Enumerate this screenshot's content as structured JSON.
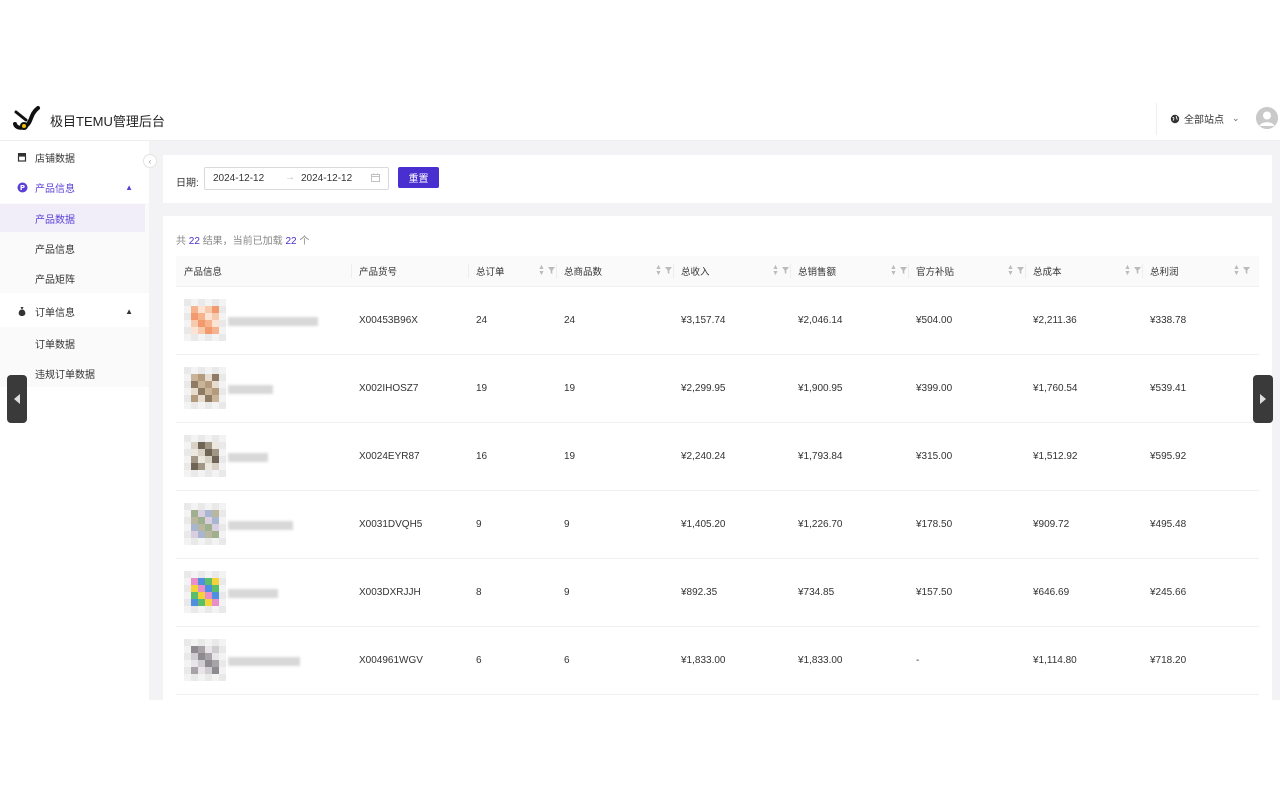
{
  "header": {
    "app_title": "极目TEMU管理后台",
    "site_selector": "全部站点"
  },
  "sidebar": {
    "items": [
      {
        "label": "店铺数据"
      },
      {
        "label": "产品信息"
      },
      {
        "label": "产品数据"
      },
      {
        "label": "产品信息"
      },
      {
        "label": "产品矩阵"
      },
      {
        "label": "订单信息"
      },
      {
        "label": "订单数据"
      },
      {
        "label": "违规订单数据"
      }
    ]
  },
  "filter": {
    "date_label": "日期:",
    "start_date": "2024-12-12",
    "end_date": "2024-12-12",
    "arrow": "→",
    "reset_label": "重置"
  },
  "summary": {
    "prefix": "共",
    "total": "22",
    "middle": "结果，当前已加载",
    "loaded": "22",
    "suffix": "个"
  },
  "table": {
    "columns": [
      "产品信息",
      "产品货号",
      "总订单",
      "总商品数",
      "总收入",
      "总销售额",
      "官方补贴",
      "总成本",
      "总利润"
    ],
    "rows": [
      {
        "sku": "X00453B96X",
        "orders": "24",
        "items": "24",
        "revenue": "¥3,157.74",
        "sales": "¥2,046.14",
        "subsidy": "¥504.00",
        "cost": "¥2,211.36",
        "profit": "¥338.78"
      },
      {
        "sku": "X002IHOSZ7",
        "orders": "19",
        "items": "19",
        "revenue": "¥2,299.95",
        "sales": "¥1,900.95",
        "subsidy": "¥399.00",
        "cost": "¥1,760.54",
        "profit": "¥539.41"
      },
      {
        "sku": "X0024EYR87",
        "orders": "16",
        "items": "19",
        "revenue": "¥2,240.24",
        "sales": "¥1,793.84",
        "subsidy": "¥315.00",
        "cost": "¥1,512.92",
        "profit": "¥595.92"
      },
      {
        "sku": "X0031DVQH5",
        "orders": "9",
        "items": "9",
        "revenue": "¥1,405.20",
        "sales": "¥1,226.70",
        "subsidy": "¥178.50",
        "cost": "¥909.72",
        "profit": "¥495.48"
      },
      {
        "sku": "X003DXRJJH",
        "orders": "8",
        "items": "9",
        "revenue": "¥892.35",
        "sales": "¥734.85",
        "subsidy": "¥157.50",
        "cost": "¥646.69",
        "profit": "¥245.66"
      },
      {
        "sku": "X004961WGV",
        "orders": "6",
        "items": "6",
        "revenue": "¥1,833.00",
        "sales": "¥1,833.00",
        "subsidy": "-",
        "cost": "¥1,114.80",
        "profit": "¥718.20"
      }
    ]
  },
  "colors": {
    "accent": "#4a2fd0",
    "active_bg": "#f1eefa",
    "app_bg": "#f3f3f5"
  },
  "icons": [
    "logo-icon",
    "globe-icon",
    "chevron-down-icon",
    "avatar-icon",
    "store-icon",
    "product-icon",
    "chevron-up-icon",
    "order-icon",
    "calendar-icon",
    "sort-icon",
    "filter-icon",
    "arrow-left-icon",
    "arrow-right-icon",
    "collapse-icon"
  ]
}
